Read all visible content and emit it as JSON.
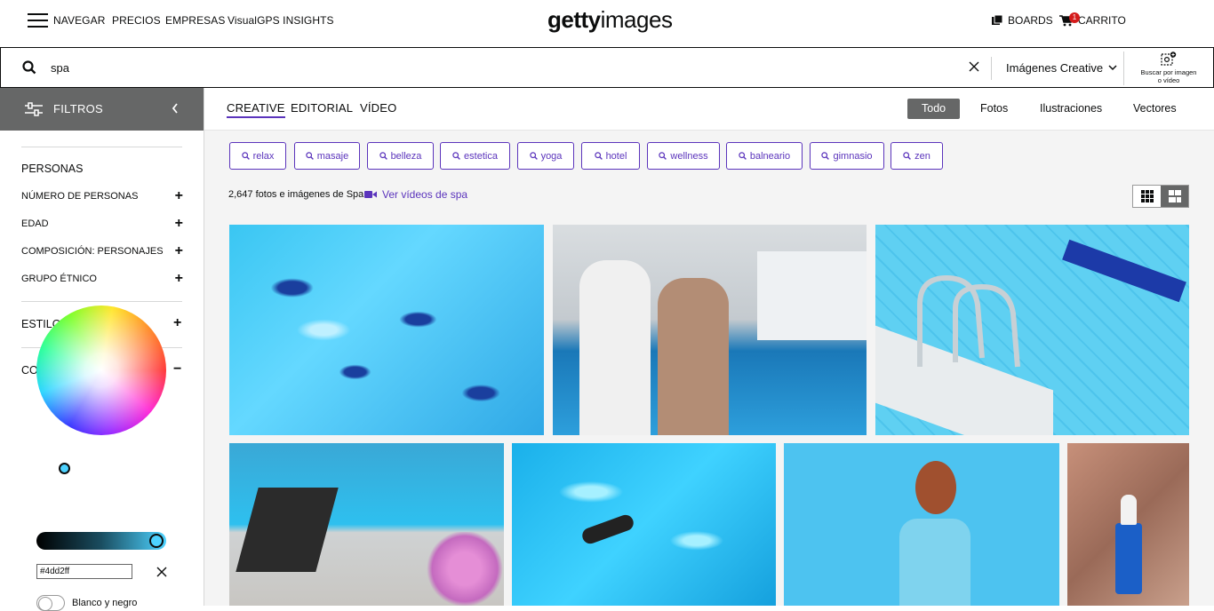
{
  "header": {
    "nav": [
      "NAVEGAR",
      "PRECIOS",
      "EMPRESAS",
      "VisualGPS INSIGHTS"
    ],
    "logo_bold": "getty",
    "logo_light": "images",
    "boards": "BOARDS",
    "cart": "CARRITO",
    "cart_count": "1"
  },
  "search": {
    "query": "spa",
    "type": "Imágenes Creative",
    "visual_search_line1": "Buscar por imagen",
    "visual_search_line2": "o vídeo"
  },
  "sidebar": {
    "title": "FILTROS",
    "sections": {
      "personas": "PERSONAS",
      "estilo": "ESTILO DE IMAGEN",
      "color": "COLOR"
    },
    "persona_items": [
      "NÚMERO DE PERSONAS",
      "EDAD",
      "COMPOSICIÓN: PERSONAJES",
      "GRUPO ÉTNICO"
    ],
    "plus": "+",
    "minus": "−",
    "color_hex": "#4dd2ff",
    "bw_label": "Blanco y negro"
  },
  "tabs": [
    "CREATIVE",
    "EDITORIAL",
    "VÍDEO"
  ],
  "types": [
    "Todo",
    "Fotos",
    "Ilustraciones",
    "Vectores"
  ],
  "chips": [
    "relax",
    "masaje",
    "belleza",
    "estetica",
    "yoga",
    "hotel",
    "wellness",
    "balneario",
    "gimnasio",
    "zen"
  ],
  "results": {
    "count": "2,647 fotos e imágenes de Spa",
    "video_link": "Ver vídeos de spa"
  },
  "colors": {
    "accent": "#5b34bc",
    "filter_header": "#666767",
    "selected_color": "#4dd2ff"
  }
}
